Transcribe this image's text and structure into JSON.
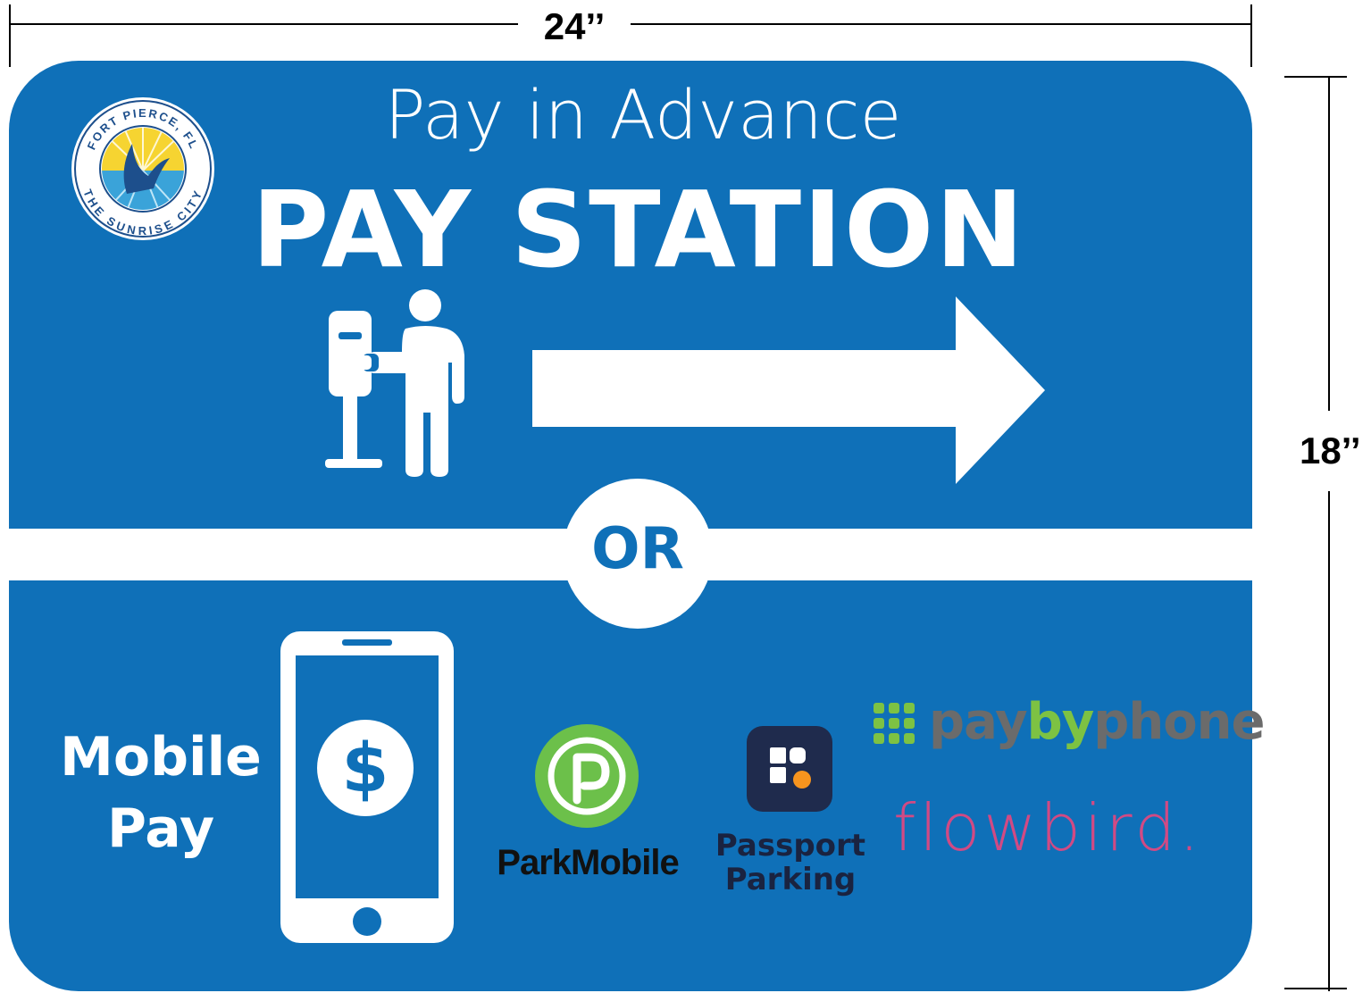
{
  "dimensions": {
    "width_label": "24’’",
    "height_label": "18’’"
  },
  "seal": {
    "top_text": "FORT PIERCE, FL",
    "bottom_text": "THE SUNRISE CITY"
  },
  "sign": {
    "subtitle": "Pay in Advance",
    "title": "PAY STATION",
    "or_label": "OR",
    "mobile_pay": "Mobile Pay",
    "colors": {
      "background": "#0f70b8",
      "foreground": "#ffffff"
    }
  },
  "providers": {
    "parkmobile": {
      "name": "ParkMobile",
      "icon": "parkmobile-p-icon",
      "color": "#6cc04a"
    },
    "passport": {
      "name_line1": "Passport",
      "name_line2": "Parking",
      "icon": "passport-app-icon"
    },
    "paybyphone": {
      "part1": "pay",
      "part2": "by",
      "part3": "phone",
      "icon": "paybyphone-grid-icon"
    },
    "flowbird": {
      "name": "flowbird."
    }
  }
}
